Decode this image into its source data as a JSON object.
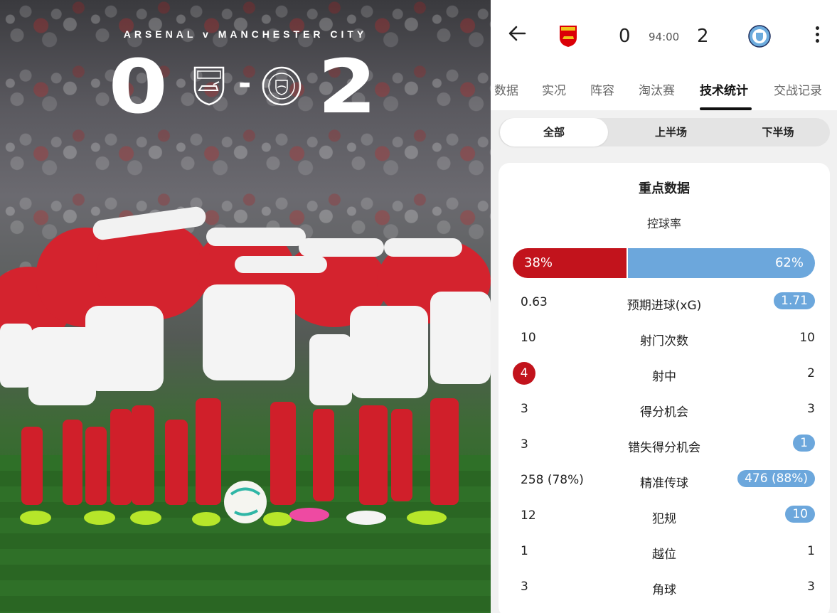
{
  "photo": {
    "title": "ARSENAL v MANCHESTER CITY",
    "home_score": "0",
    "away_score": "2",
    "separator": "-",
    "home_crest": "arsenal-crest",
    "away_crest": "man-city-crest"
  },
  "header": {
    "back_icon": "arrow-left-icon",
    "home_crest": "arsenal-crest",
    "home_score": "0",
    "clock": "94:00",
    "away_score": "2",
    "away_crest": "man-city-crest",
    "more_icon": "more-vertical-icon"
  },
  "tabs": [
    {
      "label": "数据",
      "active": false
    },
    {
      "label": "实况",
      "active": false
    },
    {
      "label": "阵容",
      "active": false
    },
    {
      "label": "淘汰赛",
      "active": false
    },
    {
      "label": "技术统计",
      "active": true
    },
    {
      "label": "交战记录",
      "active": false
    }
  ],
  "periods": [
    {
      "label": "全部",
      "active": true
    },
    {
      "label": "上半场",
      "active": false
    },
    {
      "label": "下半场",
      "active": false
    }
  ],
  "stats": {
    "title": "重点数据",
    "possession": {
      "label": "控球率",
      "home": "38%",
      "away": "62%",
      "home_fraction": 0.38
    },
    "rows": [
      {
        "label": "预期进球(xG)",
        "home": "0.63",
        "away": "1.71",
        "highlight": "away"
      },
      {
        "label": "射门次数",
        "home": "10",
        "away": "10",
        "highlight": "none"
      },
      {
        "label": "射中",
        "home": "4",
        "away": "2",
        "highlight": "home"
      },
      {
        "label": "得分机会",
        "home": "3",
        "away": "3",
        "highlight": "none"
      },
      {
        "label": "错失得分机会",
        "home": "3",
        "away": "1",
        "highlight": "away"
      },
      {
        "label": "精准传球",
        "home": "258 (78%)",
        "away": "476 (88%)",
        "highlight": "away"
      },
      {
        "label": "犯规",
        "home": "12",
        "away": "10",
        "highlight": "away"
      },
      {
        "label": "越位",
        "home": "1",
        "away": "1",
        "highlight": "none"
      },
      {
        "label": "角球",
        "home": "3",
        "away": "3",
        "highlight": "none"
      }
    ]
  },
  "colors": {
    "home": "#c2131c",
    "away": "#6ca7dc"
  }
}
